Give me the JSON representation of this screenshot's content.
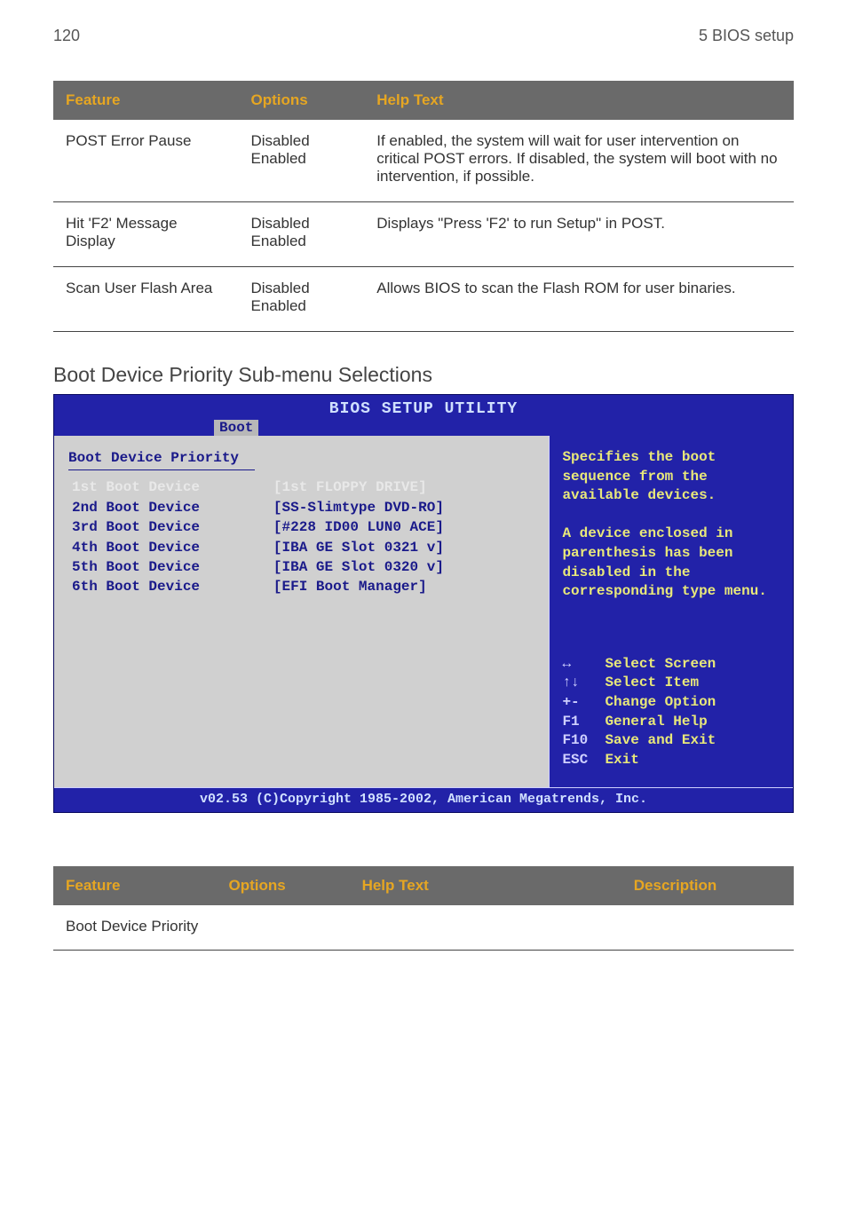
{
  "header": {
    "page_number": "120",
    "section": "5 BIOS setup"
  },
  "table1": {
    "headers": {
      "feature": "Feature",
      "options": "Options",
      "help": "Help Text"
    },
    "rows": [
      {
        "feature": "POST Error Pause",
        "option1": "Disabled",
        "option2": "Enabled",
        "help": "If enabled, the system will wait for user intervention on critical POST errors. If disabled, the system will boot with no intervention, if possible."
      },
      {
        "feature": "Hit 'F2' Message Display",
        "option1": "Disabled",
        "option2": "Enabled",
        "help": "Displays \"Press 'F2' to run Setup\" in POST."
      },
      {
        "feature": "Scan User Flash Area",
        "option1": "Disabled",
        "option2": "Enabled",
        "help": "Allows BIOS to scan the Flash ROM for user binaries."
      }
    ]
  },
  "submenu_title": "Boot Device Priority Sub-menu Selections",
  "bios": {
    "title": "BIOS SETUP UTILITY",
    "tab": "Boot",
    "panel_title": "Boot Device Priority",
    "devices": [
      {
        "label": "1st Boot Device",
        "value": "[1st FLOPPY DRIVE]"
      },
      {
        "label": "2nd Boot Device",
        "value": "[SS-Slimtype DVD-RO]"
      },
      {
        "label": "3rd Boot Device",
        "value": "[#228 ID00 LUN0 ACE]"
      },
      {
        "label": "4th Boot Device",
        "value": "[IBA GE Slot 0321 v]"
      },
      {
        "label": "5th Boot Device",
        "value": "[IBA GE Slot 0320 v]"
      },
      {
        "label": "6th Boot Device",
        "value": "[EFI Boot Manager]"
      }
    ],
    "help_text_1": "Specifies the boot sequence from the available devices.",
    "help_text_2": "A device enclosed in parenthesis has been disabled in the corresponding type menu.",
    "keys": [
      {
        "k": "↔",
        "v": "Select Screen"
      },
      {
        "k": "↑↓",
        "v": "Select Item"
      },
      {
        "k": "+-",
        "v": "Change Option"
      },
      {
        "k": "F1",
        "v": "General Help"
      },
      {
        "k": "F10",
        "v": "Save and Exit"
      },
      {
        "k": "ESC",
        "v": "Exit"
      }
    ],
    "footer": "v02.53 (C)Copyright 1985-2002, American Megatrends, Inc."
  },
  "table2": {
    "headers": {
      "feature": "Feature",
      "options": "Options",
      "help": "Help Text",
      "desc": "Description"
    },
    "rows": [
      {
        "feature": "Boot Device Priority",
        "options": "",
        "help": "",
        "desc": ""
      }
    ]
  }
}
